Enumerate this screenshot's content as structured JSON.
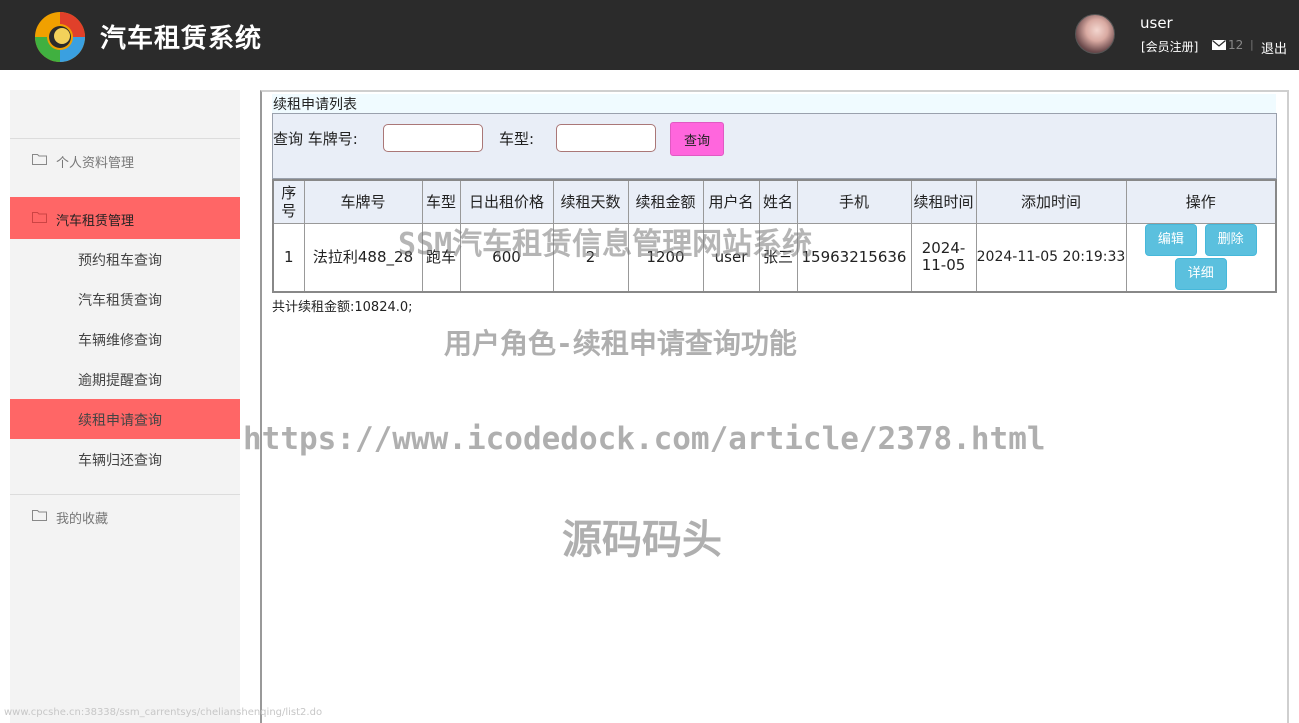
{
  "header": {
    "title": "汽车租赁系统",
    "username": "user",
    "register": "[会员注册]",
    "mail_count": "12",
    "separator": "|",
    "logout": "退出"
  },
  "sidebar": {
    "groups": [
      {
        "label": "个人资料管理"
      },
      {
        "label": "汽车租赁管理",
        "active": true
      },
      {
        "label": "我的收藏"
      }
    ],
    "subitems": [
      {
        "label": "预约租车查询"
      },
      {
        "label": "汽车租赁查询"
      },
      {
        "label": "车辆维修查询"
      },
      {
        "label": "逾期提醒查询"
      },
      {
        "label": "续租申请查询",
        "active": true
      },
      {
        "label": "车辆归还查询"
      }
    ]
  },
  "main": {
    "panel_title": "续租申请列表",
    "search": {
      "plate_label": "查询 车牌号:",
      "plate_value": "",
      "type_label": "车型:",
      "type_value": "",
      "button": "查询"
    },
    "table": {
      "headers": [
        "序号",
        "车牌号",
        "车型",
        "日出租价格",
        "续租天数",
        "续租金额",
        "用户名",
        "姓名",
        "手机",
        "续租时间",
        "添加时间",
        "操作"
      ],
      "rows": [
        {
          "index": "1",
          "plate": "法拉利488_28",
          "type": "跑车",
          "daily_price": "600",
          "days": "2",
          "amount": "1200",
          "username": "user",
          "name": "张三",
          "phone": "15963215636",
          "renew_time": "2024-11-05",
          "add_time": "2024-11-05 20:19:33",
          "actions": {
            "edit": "编辑",
            "delete": "删除",
            "detail": "详细"
          }
        }
      ]
    },
    "total": "共计续租金额:10824.0;"
  },
  "watermarks": {
    "line1": "SSM汽车租赁信息管理网站系统",
    "line2": "用户角色-续租申请查询功能",
    "line3": "https://www.icodedock.com/article/2378.html",
    "line4": "源码码头"
  },
  "footer_url": "www.cpcshe.cn:38338/ssm_carrentsys/chelianshenqing/list2.do",
  "colors": {
    "header_bg": "#2b2b2b",
    "active_menu": "#ff6666",
    "search_button": "#ff66dd",
    "action_button": "#5bc0de"
  }
}
